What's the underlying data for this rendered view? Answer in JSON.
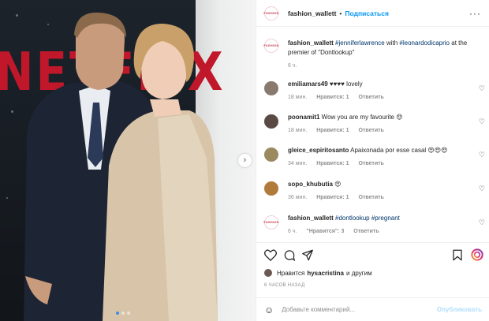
{
  "post": {
    "account": "fashion_wallett",
    "follow_label": "Подписаться",
    "more_icon": "more-icon",
    "avatar_logo": "FASHION",
    "photo_brand": "NETFLIX",
    "photo_slides": 3,
    "photo_active_slide": 1
  },
  "caption": {
    "user": "fashion_wallett",
    "tag1": "#jenniferlawrence",
    "mid": " with ",
    "tag2": "#leonardodicaprio",
    "rest": " at the premier of \"Dontlookup\"",
    "time": "6 ч."
  },
  "comments": [
    {
      "user": "emiliamars49",
      "text": " ♥♥♥♥ lovely",
      "time": "18 мин.",
      "likes": "Нравится: 1",
      "reply": "Ответить",
      "avatar_color": "#8a7a6e"
    },
    {
      "user": "poonamit1",
      "text": " Wow you are my favourite 😍",
      "time": "18 мин.",
      "likes": "Нравится: 1",
      "reply": "Ответить",
      "avatar_color": "#5a4a44"
    },
    {
      "user": "gleice_espiritosanto",
      "text": " Apaixonada por esse casal 😍😍😍",
      "time": "34 мин.",
      "likes": "Нравится: 1",
      "reply": "Ответить",
      "avatar_color": "#9a8a5e"
    },
    {
      "user": "sopo_khubutia",
      "text": " 😍",
      "time": "36 мин.",
      "likes": "Нравится: 1",
      "reply": "Ответить",
      "avatar_color": "#b07a3a"
    }
  ],
  "owner_comment": {
    "user": "fashion_wallett",
    "tag1": "#dontlookup",
    "tag2": "#pregnant",
    "time": "6 ч.",
    "likes": "\"Нравится\": 3",
    "reply": "Ответить"
  },
  "likes_line": {
    "prefix": "Нравится",
    "user": "hysacristina",
    "suffix": "и другим"
  },
  "time_ago": "6 ЧАСОВ НАЗАД",
  "comment_box": {
    "placeholder": "Добавьте комментарий...",
    "publish": "Опубликовать"
  },
  "colors": {
    "link": "#00376b",
    "follow": "#0095f6",
    "brand_red": "#c0182a"
  }
}
